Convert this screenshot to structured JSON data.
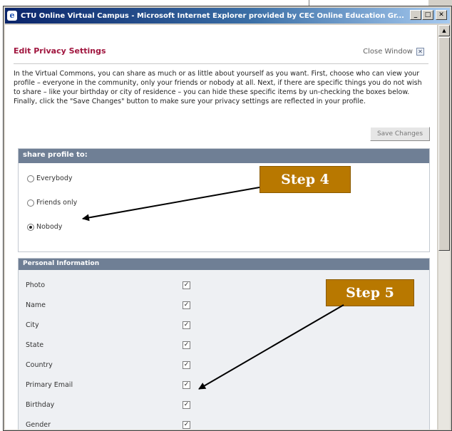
{
  "window": {
    "title": "CTU Online Virtual Campus - Microsoft Internet Explorer provided by CEC Online Education Gr...",
    "minimize_glyph": "_",
    "maximize_glyph": "□",
    "close_glyph": "✕"
  },
  "header": {
    "title": "Edit Privacy Settings",
    "close_label": "Close Window",
    "close_glyph": "✕"
  },
  "intro": "In the Virtual Commons, you can share as much or as little about yourself as you want. First, choose who can view your profile – everyone in the community, only your friends or nobody at all. Next, if there are specific things you do not wish to share – like your birthday or city of residence – you can hide these specific items by un-checking the boxes below. Finally, click the \"Save Changes\" button to make sure your privacy settings are reflected in your profile.",
  "save_button": "Save Changes",
  "share": {
    "heading": "share profile to:",
    "options": [
      {
        "label": "Everybody",
        "checked": false
      },
      {
        "label": "Friends only",
        "checked": false
      },
      {
        "label": "Nobody",
        "checked": true
      }
    ]
  },
  "personal": {
    "heading": "Personal Information",
    "check_glyph": "✓",
    "items": [
      {
        "label": "Photo",
        "checked": true
      },
      {
        "label": "Name",
        "checked": true
      },
      {
        "label": "City",
        "checked": true
      },
      {
        "label": "State",
        "checked": true
      },
      {
        "label": "Country",
        "checked": true
      },
      {
        "label": "Primary Email",
        "checked": true
      },
      {
        "label": "Birthday",
        "checked": true
      },
      {
        "label": "Gender",
        "checked": true
      }
    ]
  },
  "annotations": {
    "step4": "Step 4",
    "step5": "Step 5"
  },
  "icons": [
    "ie-icon",
    "minimize-icon",
    "maximize-icon",
    "close-icon",
    "close-window-icon",
    "scroll-up-icon",
    "arrow-icon"
  ],
  "colors": {
    "title_red": "#a0153e",
    "panel_header": "#6f7f95",
    "step_box": "#b87800"
  }
}
